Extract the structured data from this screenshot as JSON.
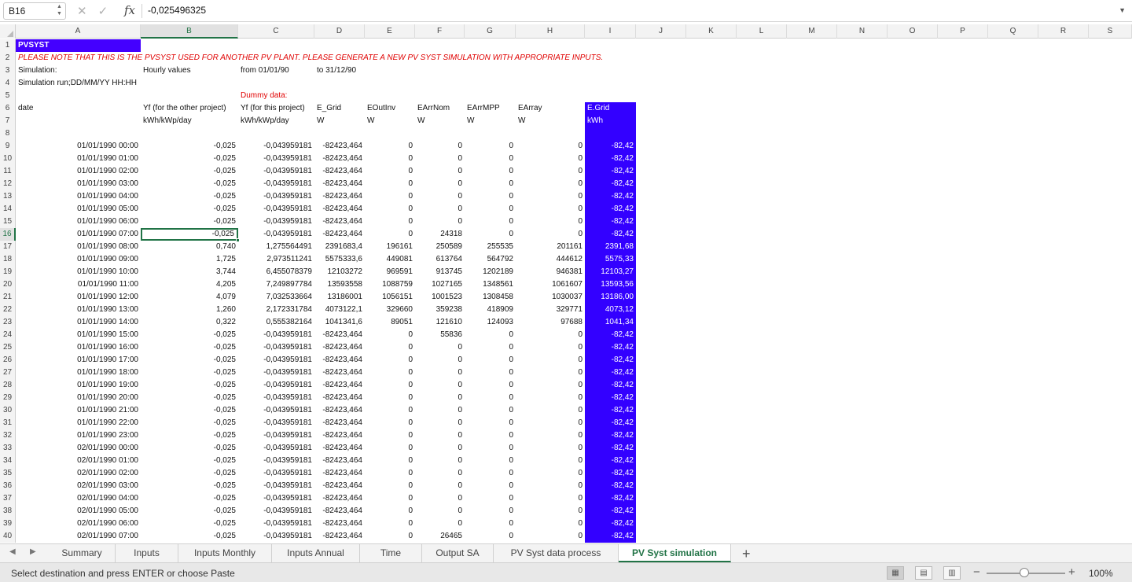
{
  "formula_bar": {
    "cell_ref": "B16",
    "cancel_icon": "✕",
    "confirm_icon": "✓",
    "fx_label": "fx",
    "value": "-0,025496325"
  },
  "columns": [
    "A",
    "B",
    "C",
    "D",
    "E",
    "F",
    "G",
    "H",
    "I",
    "J",
    "K",
    "L",
    "M",
    "N",
    "O",
    "P",
    "Q",
    "R",
    "S"
  ],
  "header_rows": {
    "r1": {
      "a": "PVSYST"
    },
    "r2": {
      "a": "PLEASE NOTE THAT THIS IS THE PVSYST USED FOR ANOTHER PV PLANT. PLEASE GENERATE A NEW PV SYST SIMULATION WITH APPROPRIATE INPUTS."
    },
    "r3": {
      "a": "Simulation:",
      "b": "Hourly values",
      "c": "from 01/01/90",
      "d": "to 31/12/90"
    },
    "r4": {
      "a": "Simulation run;DD/MM/YY HH:HH"
    },
    "r5": {
      "c": "Dummy data:"
    },
    "r6": {
      "a": "date",
      "b": "Yf (for the other project)",
      "c": "Yf (for this project)",
      "d": "E_Grid",
      "e": "EOutInv",
      "f": "EArrNom",
      "g": "EArrMPP",
      "h": "EArray",
      "i": "E.Grid"
    },
    "r7": {
      "b": "kWh/kWp/day",
      "c": "kWh/kWp/day",
      "d": "W",
      "e": "W",
      "f": "W",
      "g": "W",
      "h": "W",
      "i": "kWh"
    }
  },
  "data_rows": [
    {
      "n": "9",
      "a": "01/01/1990 00:00",
      "b": "-0,025",
      "c": "-0,043959181",
      "d": "-82423,464",
      "e": "0",
      "f": "0",
      "g": "0",
      "h": "0",
      "i": "-82,42"
    },
    {
      "n": "10",
      "a": "01/01/1990 01:00",
      "b": "-0,025",
      "c": "-0,043959181",
      "d": "-82423,464",
      "e": "0",
      "f": "0",
      "g": "0",
      "h": "0",
      "i": "-82,42"
    },
    {
      "n": "11",
      "a": "01/01/1990 02:00",
      "b": "-0,025",
      "c": "-0,043959181",
      "d": "-82423,464",
      "e": "0",
      "f": "0",
      "g": "0",
      "h": "0",
      "i": "-82,42"
    },
    {
      "n": "12",
      "a": "01/01/1990 03:00",
      "b": "-0,025",
      "c": "-0,043959181",
      "d": "-82423,464",
      "e": "0",
      "f": "0",
      "g": "0",
      "h": "0",
      "i": "-82,42"
    },
    {
      "n": "13",
      "a": "01/01/1990 04:00",
      "b": "-0,025",
      "c": "-0,043959181",
      "d": "-82423,464",
      "e": "0",
      "f": "0",
      "g": "0",
      "h": "0",
      "i": "-82,42"
    },
    {
      "n": "14",
      "a": "01/01/1990 05:00",
      "b": "-0,025",
      "c": "-0,043959181",
      "d": "-82423,464",
      "e": "0",
      "f": "0",
      "g": "0",
      "h": "0",
      "i": "-82,42"
    },
    {
      "n": "15",
      "a": "01/01/1990 06:00",
      "b": "-0,025",
      "c": "-0,043959181",
      "d": "-82423,464",
      "e": "0",
      "f": "0",
      "g": "0",
      "h": "0",
      "i": "-82,42"
    },
    {
      "n": "16",
      "a": "01/01/1990 07:00",
      "b": "-0,025",
      "c": "-0,043959181",
      "d": "-82423,464",
      "e": "0",
      "f": "24318",
      "g": "0",
      "h": "0",
      "i": "-82,42"
    },
    {
      "n": "17",
      "a": "01/01/1990 08:00",
      "b": "0,740",
      "c": "1,275564491",
      "d": "2391683,4",
      "e": "196161",
      "f": "250589",
      "g": "255535",
      "h": "201161",
      "i": "2391,68"
    },
    {
      "n": "18",
      "a": "01/01/1990 09:00",
      "b": "1,725",
      "c": "2,973511241",
      "d": "5575333,6",
      "e": "449081",
      "f": "613764",
      "g": "564792",
      "h": "444612",
      "i": "5575,33"
    },
    {
      "n": "19",
      "a": "01/01/1990 10:00",
      "b": "3,744",
      "c": "6,455078379",
      "d": "12103272",
      "e": "969591",
      "f": "913745",
      "g": "1202189",
      "h": "946381",
      "i": "12103,27"
    },
    {
      "n": "20",
      "a": "01/01/1990 11:00",
      "b": "4,205",
      "c": "7,249897784",
      "d": "13593558",
      "e": "1088759",
      "f": "1027165",
      "g": "1348561",
      "h": "1061607",
      "i": "13593,56"
    },
    {
      "n": "21",
      "a": "01/01/1990 12:00",
      "b": "4,079",
      "c": "7,032533664",
      "d": "13186001",
      "e": "1056151",
      "f": "1001523",
      "g": "1308458",
      "h": "1030037",
      "i": "13186,00"
    },
    {
      "n": "22",
      "a": "01/01/1990 13:00",
      "b": "1,260",
      "c": "2,172331784",
      "d": "4073122,1",
      "e": "329660",
      "f": "359238",
      "g": "418909",
      "h": "329771",
      "i": "4073,12"
    },
    {
      "n": "23",
      "a": "01/01/1990 14:00",
      "b": "0,322",
      "c": "0,555382164",
      "d": "1041341,6",
      "e": "89051",
      "f": "121610",
      "g": "124093",
      "h": "97688",
      "i": "1041,34"
    },
    {
      "n": "24",
      "a": "01/01/1990 15:00",
      "b": "-0,025",
      "c": "-0,043959181",
      "d": "-82423,464",
      "e": "0",
      "f": "55836",
      "g": "0",
      "h": "0",
      "i": "-82,42"
    },
    {
      "n": "25",
      "a": "01/01/1990 16:00",
      "b": "-0,025",
      "c": "-0,043959181",
      "d": "-82423,464",
      "e": "0",
      "f": "0",
      "g": "0",
      "h": "0",
      "i": "-82,42"
    },
    {
      "n": "26",
      "a": "01/01/1990 17:00",
      "b": "-0,025",
      "c": "-0,043959181",
      "d": "-82423,464",
      "e": "0",
      "f": "0",
      "g": "0",
      "h": "0",
      "i": "-82,42"
    },
    {
      "n": "27",
      "a": "01/01/1990 18:00",
      "b": "-0,025",
      "c": "-0,043959181",
      "d": "-82423,464",
      "e": "0",
      "f": "0",
      "g": "0",
      "h": "0",
      "i": "-82,42"
    },
    {
      "n": "28",
      "a": "01/01/1990 19:00",
      "b": "-0,025",
      "c": "-0,043959181",
      "d": "-82423,464",
      "e": "0",
      "f": "0",
      "g": "0",
      "h": "0",
      "i": "-82,42"
    },
    {
      "n": "29",
      "a": "01/01/1990 20:00",
      "b": "-0,025",
      "c": "-0,043959181",
      "d": "-82423,464",
      "e": "0",
      "f": "0",
      "g": "0",
      "h": "0",
      "i": "-82,42"
    },
    {
      "n": "30",
      "a": "01/01/1990 21:00",
      "b": "-0,025",
      "c": "-0,043959181",
      "d": "-82423,464",
      "e": "0",
      "f": "0",
      "g": "0",
      "h": "0",
      "i": "-82,42"
    },
    {
      "n": "31",
      "a": "01/01/1990 22:00",
      "b": "-0,025",
      "c": "-0,043959181",
      "d": "-82423,464",
      "e": "0",
      "f": "0",
      "g": "0",
      "h": "0",
      "i": "-82,42"
    },
    {
      "n": "32",
      "a": "01/01/1990 23:00",
      "b": "-0,025",
      "c": "-0,043959181",
      "d": "-82423,464",
      "e": "0",
      "f": "0",
      "g": "0",
      "h": "0",
      "i": "-82,42"
    },
    {
      "n": "33",
      "a": "02/01/1990 00:00",
      "b": "-0,025",
      "c": "-0,043959181",
      "d": "-82423,464",
      "e": "0",
      "f": "0",
      "g": "0",
      "h": "0",
      "i": "-82,42"
    },
    {
      "n": "34",
      "a": "02/01/1990 01:00",
      "b": "-0,025",
      "c": "-0,043959181",
      "d": "-82423,464",
      "e": "0",
      "f": "0",
      "g": "0",
      "h": "0",
      "i": "-82,42"
    },
    {
      "n": "35",
      "a": "02/01/1990 02:00",
      "b": "-0,025",
      "c": "-0,043959181",
      "d": "-82423,464",
      "e": "0",
      "f": "0",
      "g": "0",
      "h": "0",
      "i": "-82,42"
    },
    {
      "n": "36",
      "a": "02/01/1990 03:00",
      "b": "-0,025",
      "c": "-0,043959181",
      "d": "-82423,464",
      "e": "0",
      "f": "0",
      "g": "0",
      "h": "0",
      "i": "-82,42"
    },
    {
      "n": "37",
      "a": "02/01/1990 04:00",
      "b": "-0,025",
      "c": "-0,043959181",
      "d": "-82423,464",
      "e": "0",
      "f": "0",
      "g": "0",
      "h": "0",
      "i": "-82,42"
    },
    {
      "n": "38",
      "a": "02/01/1990 05:00",
      "b": "-0,025",
      "c": "-0,043959181",
      "d": "-82423,464",
      "e": "0",
      "f": "0",
      "g": "0",
      "h": "0",
      "i": "-82,42"
    },
    {
      "n": "39",
      "a": "02/01/1990 06:00",
      "b": "-0,025",
      "c": "-0,043959181",
      "d": "-82423,464",
      "e": "0",
      "f": "0",
      "g": "0",
      "h": "0",
      "i": "-82,42"
    },
    {
      "n": "40",
      "a": "02/01/1990 07:00",
      "b": "-0,025",
      "c": "-0,043959181",
      "d": "-82423,464",
      "e": "0",
      "f": "26465",
      "g": "0",
      "h": "0",
      "i": "-82,42"
    }
  ],
  "sheet_tabs": [
    "Summary",
    "Inputs",
    "Inputs Monthly",
    "Inputs Annual",
    "Time",
    "Output SA",
    "PV Syst data process",
    "PV Syst simulation"
  ],
  "active_tab": "PV Syst simulation",
  "add_sheet_icon": "+",
  "status": {
    "message": "Select destination and press ENTER or choose Paste",
    "zoom": "100%",
    "zoom_minus": "−",
    "zoom_plus": "+"
  },
  "colors": {
    "selection_green": "#217346",
    "egrid_column": "#3300ff",
    "note_red": "#e00000"
  }
}
